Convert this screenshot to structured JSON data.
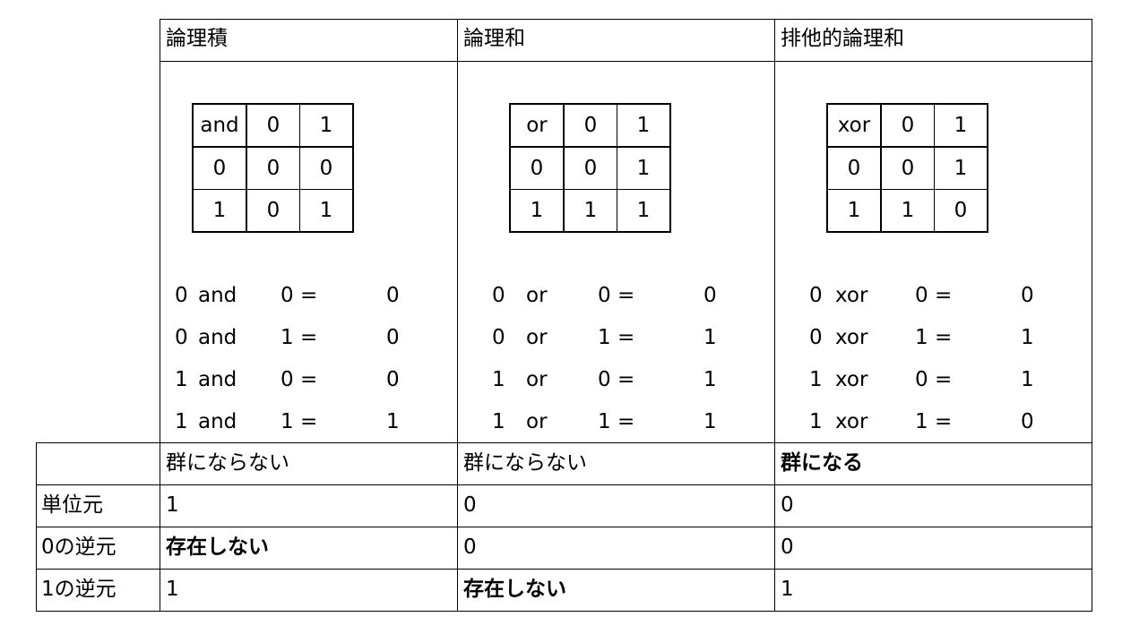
{
  "columns": [
    {
      "header": "論理積",
      "operator": "and",
      "truth_table": {
        "corner": "and",
        "col_heads": [
          "0",
          "1"
        ],
        "rows": [
          {
            "head": "0",
            "cells": [
              "0",
              "0"
            ]
          },
          {
            "head": "1",
            "cells": [
              "0",
              "1"
            ]
          }
        ]
      },
      "equations": [
        {
          "a": "0",
          "op": "and",
          "b": "0 =",
          "result": "0"
        },
        {
          "a": "0",
          "op": "and",
          "b": "1 =",
          "result": "0"
        },
        {
          "a": "1",
          "op": "and",
          "b": "0 =",
          "result": "0"
        },
        {
          "a": "1",
          "op": "and",
          "b": "1 =",
          "result": "1"
        }
      ],
      "group_status": "群にならない",
      "identity": "1",
      "inverse_of_0": "存在しない",
      "inverse_of_1": "1"
    },
    {
      "header": "論理和",
      "operator": "or",
      "truth_table": {
        "corner": "or",
        "col_heads": [
          "0",
          "1"
        ],
        "rows": [
          {
            "head": "0",
            "cells": [
              "0",
              "1"
            ]
          },
          {
            "head": "1",
            "cells": [
              "1",
              "1"
            ]
          }
        ]
      },
      "equations": [
        {
          "a": "0",
          "op": "or",
          "b": "0 =",
          "result": "0"
        },
        {
          "a": "0",
          "op": "or",
          "b": "1 =",
          "result": "1"
        },
        {
          "a": "1",
          "op": "or",
          "b": "0 =",
          "result": "1"
        },
        {
          "a": "1",
          "op": "or",
          "b": "1 =",
          "result": "1"
        }
      ],
      "group_status": "群にならない",
      "identity": "0",
      "inverse_of_0": "0",
      "inverse_of_1": "存在しない"
    },
    {
      "header": "排他的論理和",
      "operator": "xor",
      "truth_table": {
        "corner": "xor",
        "col_heads": [
          "0",
          "1"
        ],
        "rows": [
          {
            "head": "0",
            "cells": [
              "0",
              "1"
            ]
          },
          {
            "head": "1",
            "cells": [
              "1",
              "0"
            ]
          }
        ]
      },
      "equations": [
        {
          "a": "0",
          "op": "xor",
          "b": "0 =",
          "result": "0"
        },
        {
          "a": "0",
          "op": "xor",
          "b": "1 =",
          "result": "1"
        },
        {
          "a": "1",
          "op": "xor",
          "b": "0 =",
          "result": "1"
        },
        {
          "a": "1",
          "op": "xor",
          "b": "1 =",
          "result": "0"
        }
      ],
      "group_status": "群になる",
      "identity": "0",
      "inverse_of_0": "0",
      "inverse_of_1": "1"
    }
  ],
  "row_labels": {
    "group_status": "",
    "identity": "単位元",
    "inverse_of_0": "0の逆元",
    "inverse_of_1": "1の逆元"
  },
  "emphasis": {
    "bold_values": [
      "存在しない",
      "群になる"
    ]
  }
}
